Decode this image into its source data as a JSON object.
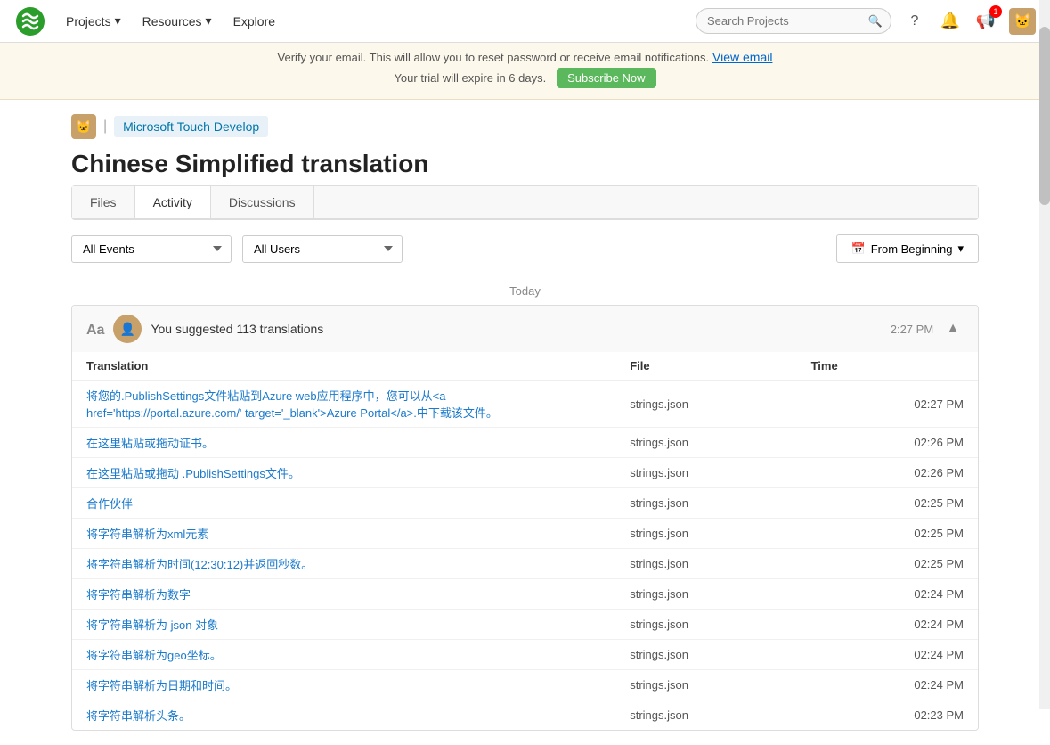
{
  "nav": {
    "logo_alt": "Crowdin Logo",
    "links": [
      {
        "label": "Projects",
        "has_dropdown": true
      },
      {
        "label": "Resources",
        "has_dropdown": true
      },
      {
        "label": "Explore",
        "has_dropdown": false
      }
    ],
    "search_placeholder": "Search Projects",
    "icons": {
      "help": "?",
      "notifications": "🔔",
      "notifications_badge": "1",
      "messages": "📢"
    }
  },
  "verify_bar": {
    "text": "Verify your email. This will allow you to reset password or receive email notifications.",
    "view_email_label": "View email",
    "trial_text": "Your trial will expire in 6 days.",
    "subscribe_label": "Subscribe Now"
  },
  "breadcrumb": {
    "project_icon": "🐱",
    "project_name": "Microsoft Touch Develop"
  },
  "page": {
    "title": "Chinese Simplified translation"
  },
  "tabs": [
    {
      "label": "Files",
      "active": false
    },
    {
      "label": "Activity",
      "active": true
    },
    {
      "label": "Discussions",
      "active": false
    }
  ],
  "filters": {
    "events_options": [
      "All Events"
    ],
    "events_selected": "All Events",
    "users_options": [
      "All Users"
    ],
    "users_selected": "All Users",
    "date_label": "From Beginning"
  },
  "activity": {
    "date_group": "Today",
    "entry": {
      "action_icon": "Aa",
      "user_avatar": "👤",
      "description": "You suggested 113 translations",
      "time": "2:27 PM",
      "table": {
        "columns": [
          "Translation",
          "File",
          "Time"
        ],
        "rows": [
          {
            "translation": "将您的.PublishSettings文件粘贴到Azure web应用程序中，您可以从<a href='https://portal.azure.com/' target='_blank'>Azure Portal</a>.中下载该文件。",
            "file": "strings.json",
            "time": "02:27 PM"
          },
          {
            "translation": "在这里粘贴或拖动证书。",
            "file": "strings.json",
            "time": "02:26 PM"
          },
          {
            "translation": "在这里粘贴或拖动 .PublishSettings文件。",
            "file": "strings.json",
            "time": "02:26 PM"
          },
          {
            "translation": "合作伙伴",
            "file": "strings.json",
            "time": "02:25 PM"
          },
          {
            "translation": "将字符串解析为xml元素",
            "file": "strings.json",
            "time": "02:25 PM"
          },
          {
            "translation": "将字符串解析为时间(12:30:12)并返回秒数。",
            "file": "strings.json",
            "time": "02:25 PM"
          },
          {
            "translation": "将字符串解析为数字",
            "file": "strings.json",
            "time": "02:24 PM"
          },
          {
            "translation": "将字符串解析为 json 对象",
            "file": "strings.json",
            "time": "02:24 PM"
          },
          {
            "translation": "将字符串解析为geo坐标。",
            "file": "strings.json",
            "time": "02:24 PM"
          },
          {
            "translation": "将字符串解析为日期和时间。",
            "file": "strings.json",
            "time": "02:24 PM"
          },
          {
            "translation": "将字符串解析头条。",
            "file": "strings.json",
            "time": "02:23 PM"
          }
        ]
      }
    }
  }
}
